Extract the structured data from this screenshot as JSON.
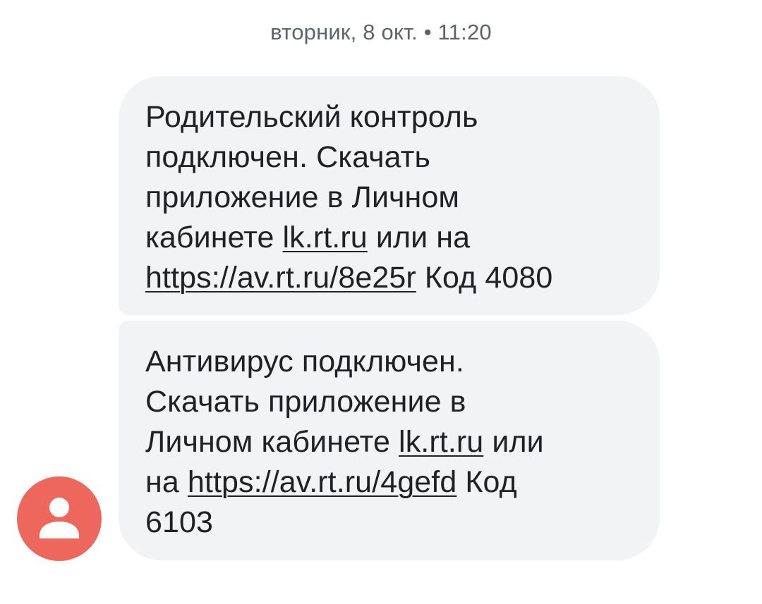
{
  "timestamp": "вторник, 8 окт. • 11:20",
  "messages": [
    {
      "lines": [
        {
          "text": "Родительский контроль"
        },
        {
          "text": "подключен. Скачать"
        },
        {
          "text": "приложение в Личном"
        },
        {
          "pre": "кабинете ",
          "link": "lk.rt.ru",
          "post": " или на"
        },
        {
          "pre": "",
          "link": "https://av.rt.ru/8e25r",
          "post": " Код 4080"
        }
      ]
    },
    {
      "lines": [
        {
          "text": "Антивирус подключен."
        },
        {
          "text": "Скачать приложение в"
        },
        {
          "pre": "Личном кабинете ",
          "link": "lk.rt.ru",
          "post": " или"
        },
        {
          "pre": "на ",
          "link": "https://av.rt.ru/4gefd",
          "post": " Код"
        },
        {
          "text": "6103"
        }
      ]
    }
  ],
  "avatar": {
    "icon": "person-icon",
    "color": "#ee675c"
  }
}
